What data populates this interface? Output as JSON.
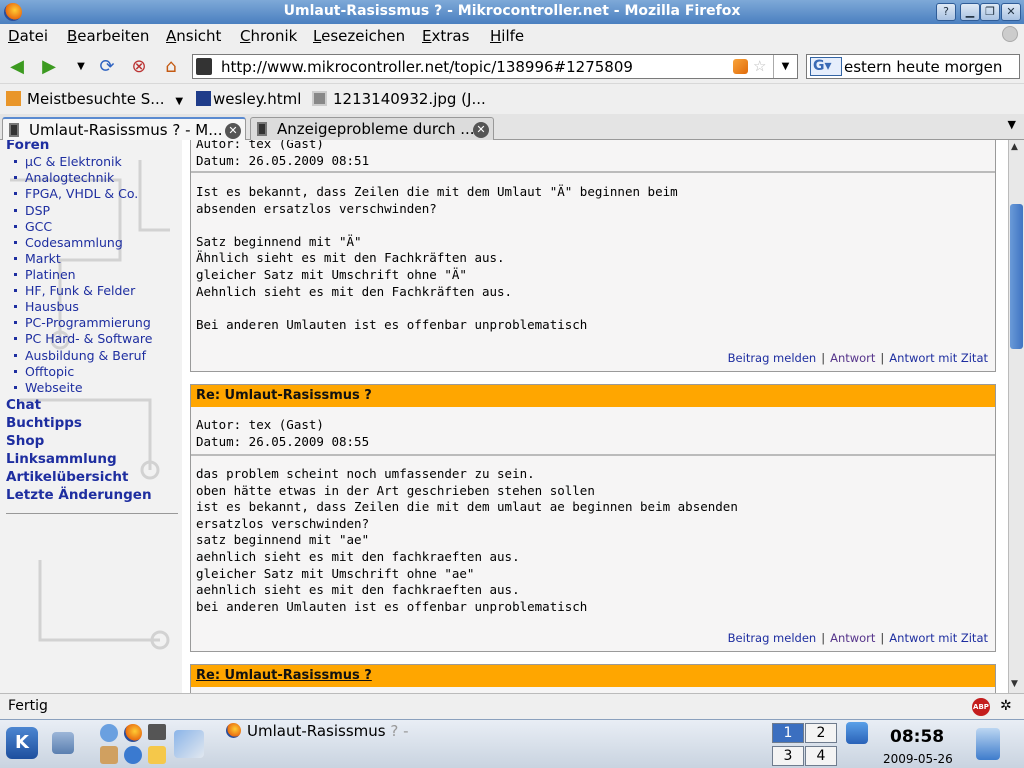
{
  "window": {
    "title": "Umlaut-Rasissmus ? - Mikrocontroller.net - Mozilla Firefox"
  },
  "menu": [
    "Datei",
    "Bearbeiten",
    "Ansicht",
    "Chronik",
    "Lesezeichen",
    "Extras",
    "Hilfe"
  ],
  "nav": {
    "url": "http://www.mikrocontroller.net/topic/138996#1275809",
    "search_value": "estern heute morgen"
  },
  "bookmarks": [
    "Meistbesuchte S...",
    "wesley.html",
    "1213140932.jpg (J..."
  ],
  "tabs": [
    {
      "label": "Umlaut-Rasissmus ? - M..."
    },
    {
      "label": "Anzeigeprobleme durch ..."
    }
  ],
  "sidebar": {
    "forums_heading": "Foren",
    "forums": [
      "µC & Elektronik",
      "Analogtechnik",
      "FPGA, VHDL & Co.",
      "DSP",
      "GCC",
      "Codesammlung",
      "Markt",
      "Platinen",
      "HF, Funk & Felder",
      "Hausbus",
      "PC-Programmierung",
      "PC Hard- & Software",
      "Ausbildung & Beruf",
      "Offtopic",
      "Webseite"
    ],
    "links": [
      "Chat",
      "Buchtipps",
      "Shop",
      "Linksammlung",
      "Artikelübersicht",
      "Letzte Änderungen"
    ]
  },
  "posts": [
    {
      "author": "Autor: tex (Gast)",
      "date": "Datum: 26.05.2009 08:51",
      "body": "Ist es bekannt, dass Zeilen die mit dem Umlaut \"Ä\" beginnen beim\nabsenden ersatzlos verschwinden?\n\nSatz beginnend mit \"Ä\"\nÄhnlich sieht es mit den Fachkräften aus.\ngleicher Satz mit Umschrift ohne \"Ä\"\nAehnlich sieht es mit den Fachkräften aus.\n\nBei anderen Umlauten ist es offenbar unproblematisch"
    },
    {
      "title": "Re: Umlaut-Rasissmus ?",
      "author": "Autor: tex (Gast)",
      "date": "Datum: 26.05.2009 08:55",
      "body": "das problem scheint noch umfassender zu sein.\noben hätte etwas in der Art geschrieben stehen sollen\nist es bekannt, dass Zeilen die mit dem umlaut ae beginnen beim absenden\nersatzlos verschwinden?\nsatz beginnend mit \"ae\"\naehnlich sieht es mit den fachkraeften aus.\ngleicher Satz mit Umschrift ohne \"ae\"\naehnlich sieht es mit den fachkraeften aus.\nbei anderen Umlauten ist es offenbar unproblematisch"
    },
    {
      "title": "Re: Umlaut-Rasissmus ?"
    }
  ],
  "post_actions": {
    "report": "Beitrag melden",
    "reply": "Antwort",
    "quote": "Antwort mit Zitat"
  },
  "status": {
    "text": "Fertig"
  },
  "taskbar": {
    "task_title": "Umlaut-Rasissmus",
    "task_suffix": "? -",
    "pager": [
      "1",
      "2",
      "3",
      "4"
    ],
    "time": "08:58",
    "date": "2009-05-26"
  }
}
